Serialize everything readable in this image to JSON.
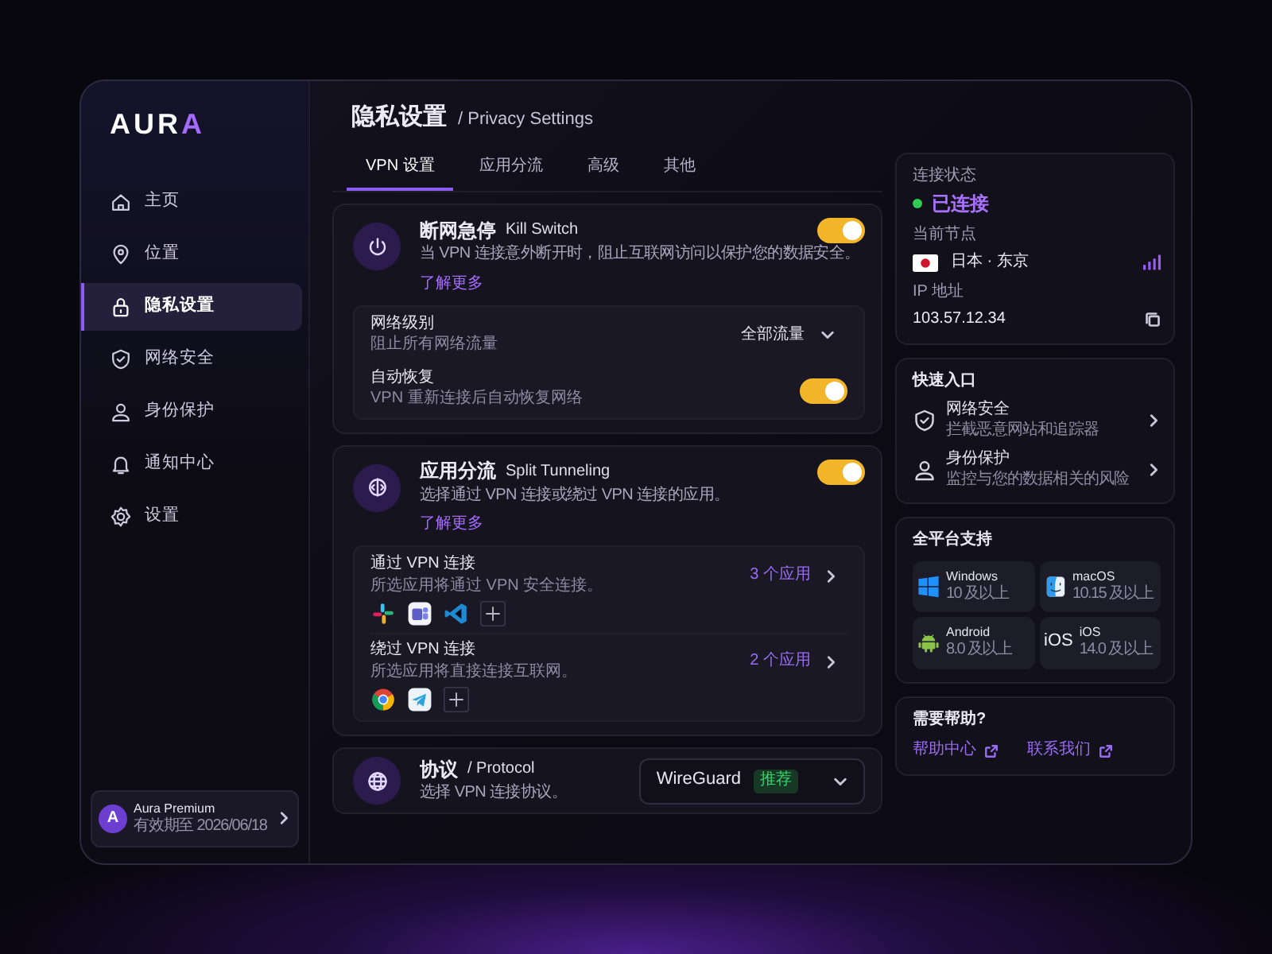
{
  "brand": {
    "text": "AURA"
  },
  "sidebar": {
    "items": [
      {
        "label": "主页",
        "selected": false
      },
      {
        "label": "位置",
        "selected": false
      },
      {
        "label": "隐私设置",
        "selected": true
      },
      {
        "label": "网络安全",
        "selected": false
      },
      {
        "label": "身份保护",
        "selected": false
      },
      {
        "label": "通知中心",
        "selected": false
      },
      {
        "label": "设置",
        "selected": false
      }
    ],
    "account": {
      "avatar": "A",
      "name": "Aura Premium",
      "expiry": "有效期至 2026/06/18"
    }
  },
  "header": {
    "title": "隐私设置",
    "subtitle": "/ Privacy Settings"
  },
  "tabs": [
    {
      "label": "VPN 设置",
      "selected": true
    },
    {
      "label": "应用分流",
      "selected": false
    },
    {
      "label": "高级",
      "selected": false
    },
    {
      "label": "其他",
      "selected": false
    }
  ],
  "kill_switch": {
    "title": "断网急停",
    "title_en": "Kill Switch",
    "description": "当 VPN 连接意外断开时，阻止互联网访问以保护您的数据安全。",
    "link": "了解更多",
    "on": true,
    "options": [
      {
        "kind": "select",
        "label": "网络级别",
        "description": "阻止所有网络流量",
        "value": "全部流量"
      },
      {
        "kind": "toggle",
        "label": "自动恢复",
        "description": "VPN 重新连接后自动恢复网络",
        "on": true
      }
    ]
  },
  "split_tunneling": {
    "title": "应用分流",
    "title_en": "Split Tunneling",
    "description": "选择通过 VPN 连接或绕过 VPN 连接的应用。",
    "link": "了解更多",
    "on": true,
    "groups": [
      {
        "label": "通过 VPN 连接",
        "description": "所选应用将通过 VPN 安全连接。",
        "count": "3 个应用"
      },
      {
        "label": "绕过 VPN 连接",
        "description": "所选应用将直接连接互联网。",
        "count": "2 个应用"
      }
    ]
  },
  "protocol": {
    "title": "协议",
    "title_en": "/ Protocol",
    "description": "选择 VPN 连接协议。",
    "value": "WireGuard",
    "badge": "推荐"
  },
  "status": {
    "label": "连接状态",
    "state": "已连接",
    "color": "#2ecc55",
    "node_label": "当前节点",
    "node": "日本 · 东京",
    "ip_label": "IP 地址",
    "ip": "103.57.12.34"
  },
  "quick_access": {
    "title": "快速入口",
    "items": [
      {
        "title": "网络安全",
        "description": "拦截恶意网站和追踪器"
      },
      {
        "title": "身份保护",
        "description": "监控与您的数据相关的风险"
      }
    ]
  },
  "platforms": {
    "title": "全平台支持",
    "items": [
      {
        "kind": "tiles",
        "name": "Windows",
        "version": "10 及以上"
      },
      {
        "kind": "face",
        "name": "macOS",
        "version": "10.15 及以上"
      },
      {
        "kind": "robot",
        "name": "Android",
        "version": "8.0 及以上"
      },
      {
        "kind": "text",
        "glyph": "iOS",
        "name": "iOS",
        "version": "14.0 及以上"
      }
    ]
  },
  "help": {
    "title": "需要帮助?",
    "links": [
      "帮助中心",
      "联系我们"
    ]
  }
}
